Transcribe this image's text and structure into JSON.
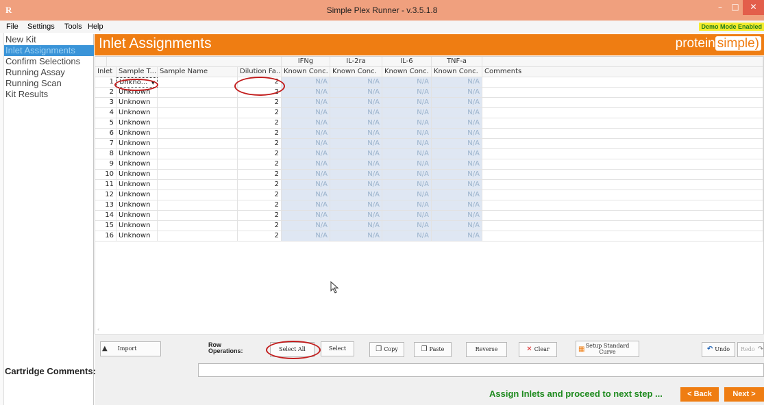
{
  "window": {
    "app_icon": "R",
    "title": "Simple Plex Runner - v.3.5.1.8",
    "minimize_icon": "minimize-icon",
    "maximize_icon": "maximize-icon",
    "close_icon": "close-icon"
  },
  "menu": {
    "items": [
      "File",
      "Settings",
      "Tools",
      "Help"
    ],
    "demo_badge": "Demo Mode Enabled"
  },
  "sidebar": {
    "items": [
      {
        "label": "New Kit",
        "active": false
      },
      {
        "label": "Inlet Assignments",
        "active": true
      },
      {
        "label": "Confirm Selections",
        "active": false
      },
      {
        "label": "Running Assay",
        "active": false
      },
      {
        "label": "Running Scan",
        "active": false
      },
      {
        "label": "Kit Results",
        "active": false
      }
    ]
  },
  "header": {
    "title": "Inlet Assignments",
    "logo_part1": "protein",
    "logo_part2": "simple",
    "logo_part3": ")"
  },
  "grid": {
    "group_headers": [
      "IFNg",
      "IL-2ra",
      "IL-6",
      "TNF-a"
    ],
    "columns": [
      "Inlet",
      "Sample T...",
      "Sample Name",
      "Dilution Fa...",
      "Known Conc.",
      "Known Conc.",
      "Known Conc.",
      "Known Conc.",
      "Comments"
    ],
    "rows": [
      {
        "inlet": "1",
        "sample_type": "Unkno...",
        "sample_name": "",
        "dilution": "2",
        "conc": [
          "N/A",
          "N/A",
          "N/A",
          "N/A"
        ],
        "comments": ""
      },
      {
        "inlet": "2",
        "sample_type": "Unknown",
        "sample_name": "",
        "dilution": "2",
        "conc": [
          "N/A",
          "N/A",
          "N/A",
          "N/A"
        ],
        "comments": ""
      },
      {
        "inlet": "3",
        "sample_type": "Unknown",
        "sample_name": "",
        "dilution": "2",
        "conc": [
          "N/A",
          "N/A",
          "N/A",
          "N/A"
        ],
        "comments": ""
      },
      {
        "inlet": "4",
        "sample_type": "Unknown",
        "sample_name": "",
        "dilution": "2",
        "conc": [
          "N/A",
          "N/A",
          "N/A",
          "N/A"
        ],
        "comments": ""
      },
      {
        "inlet": "5",
        "sample_type": "Unknown",
        "sample_name": "",
        "dilution": "2",
        "conc": [
          "N/A",
          "N/A",
          "N/A",
          "N/A"
        ],
        "comments": ""
      },
      {
        "inlet": "6",
        "sample_type": "Unknown",
        "sample_name": "",
        "dilution": "2",
        "conc": [
          "N/A",
          "N/A",
          "N/A",
          "N/A"
        ],
        "comments": ""
      },
      {
        "inlet": "7",
        "sample_type": "Unknown",
        "sample_name": "",
        "dilution": "2",
        "conc": [
          "N/A",
          "N/A",
          "N/A",
          "N/A"
        ],
        "comments": ""
      },
      {
        "inlet": "8",
        "sample_type": "Unknown",
        "sample_name": "",
        "dilution": "2",
        "conc": [
          "N/A",
          "N/A",
          "N/A",
          "N/A"
        ],
        "comments": ""
      },
      {
        "inlet": "9",
        "sample_type": "Unknown",
        "sample_name": "",
        "dilution": "2",
        "conc": [
          "N/A",
          "N/A",
          "N/A",
          "N/A"
        ],
        "comments": ""
      },
      {
        "inlet": "10",
        "sample_type": "Unknown",
        "sample_name": "",
        "dilution": "2",
        "conc": [
          "N/A",
          "N/A",
          "N/A",
          "N/A"
        ],
        "comments": ""
      },
      {
        "inlet": "11",
        "sample_type": "Unknown",
        "sample_name": "",
        "dilution": "2",
        "conc": [
          "N/A",
          "N/A",
          "N/A",
          "N/A"
        ],
        "comments": ""
      },
      {
        "inlet": "12",
        "sample_type": "Unknown",
        "sample_name": "",
        "dilution": "2",
        "conc": [
          "N/A",
          "N/A",
          "N/A",
          "N/A"
        ],
        "comments": ""
      },
      {
        "inlet": "13",
        "sample_type": "Unknown",
        "sample_name": "",
        "dilution": "2",
        "conc": [
          "N/A",
          "N/A",
          "N/A",
          "N/A"
        ],
        "comments": ""
      },
      {
        "inlet": "14",
        "sample_type": "Unknown",
        "sample_name": "",
        "dilution": "2",
        "conc": [
          "N/A",
          "N/A",
          "N/A",
          "N/A"
        ],
        "comments": ""
      },
      {
        "inlet": "15",
        "sample_type": "Unknown",
        "sample_name": "",
        "dilution": "2",
        "conc": [
          "N/A",
          "N/A",
          "N/A",
          "N/A"
        ],
        "comments": ""
      },
      {
        "inlet": "16",
        "sample_type": "Unknown",
        "sample_name": "",
        "dilution": "2",
        "conc": [
          "N/A",
          "N/A",
          "N/A",
          "N/A"
        ],
        "comments": ""
      }
    ]
  },
  "toolbar": {
    "import_label": "Import",
    "row_ops_label_1": "Row",
    "row_ops_label_2": "Operations:",
    "select_all_label": "Select All",
    "select_label": "Select",
    "copy_label": "Copy",
    "paste_label": "Paste",
    "reverse_label": "Reverse",
    "clear_label": "Clear",
    "setup_curve_label_1": "Setup Standard",
    "setup_curve_label_2": "Curve",
    "undo_label": "Undo",
    "redo_label": "Redo"
  },
  "footer": {
    "cartridge_comments_label": "Cartridge Comments:",
    "cartridge_comments_value": "",
    "status_text": "Assign Inlets and proceed to next step ...",
    "back_label": "< Back",
    "next_label": "Next >"
  },
  "colors": {
    "accent_orange": "#ef7d12",
    "titlebar": "#f0a07e",
    "sidebar_active": "#3a94d8",
    "status_green": "#1e8a1e",
    "demo_badge_bg": "#f5ec2d",
    "annotation_red": "#c21d1d"
  }
}
